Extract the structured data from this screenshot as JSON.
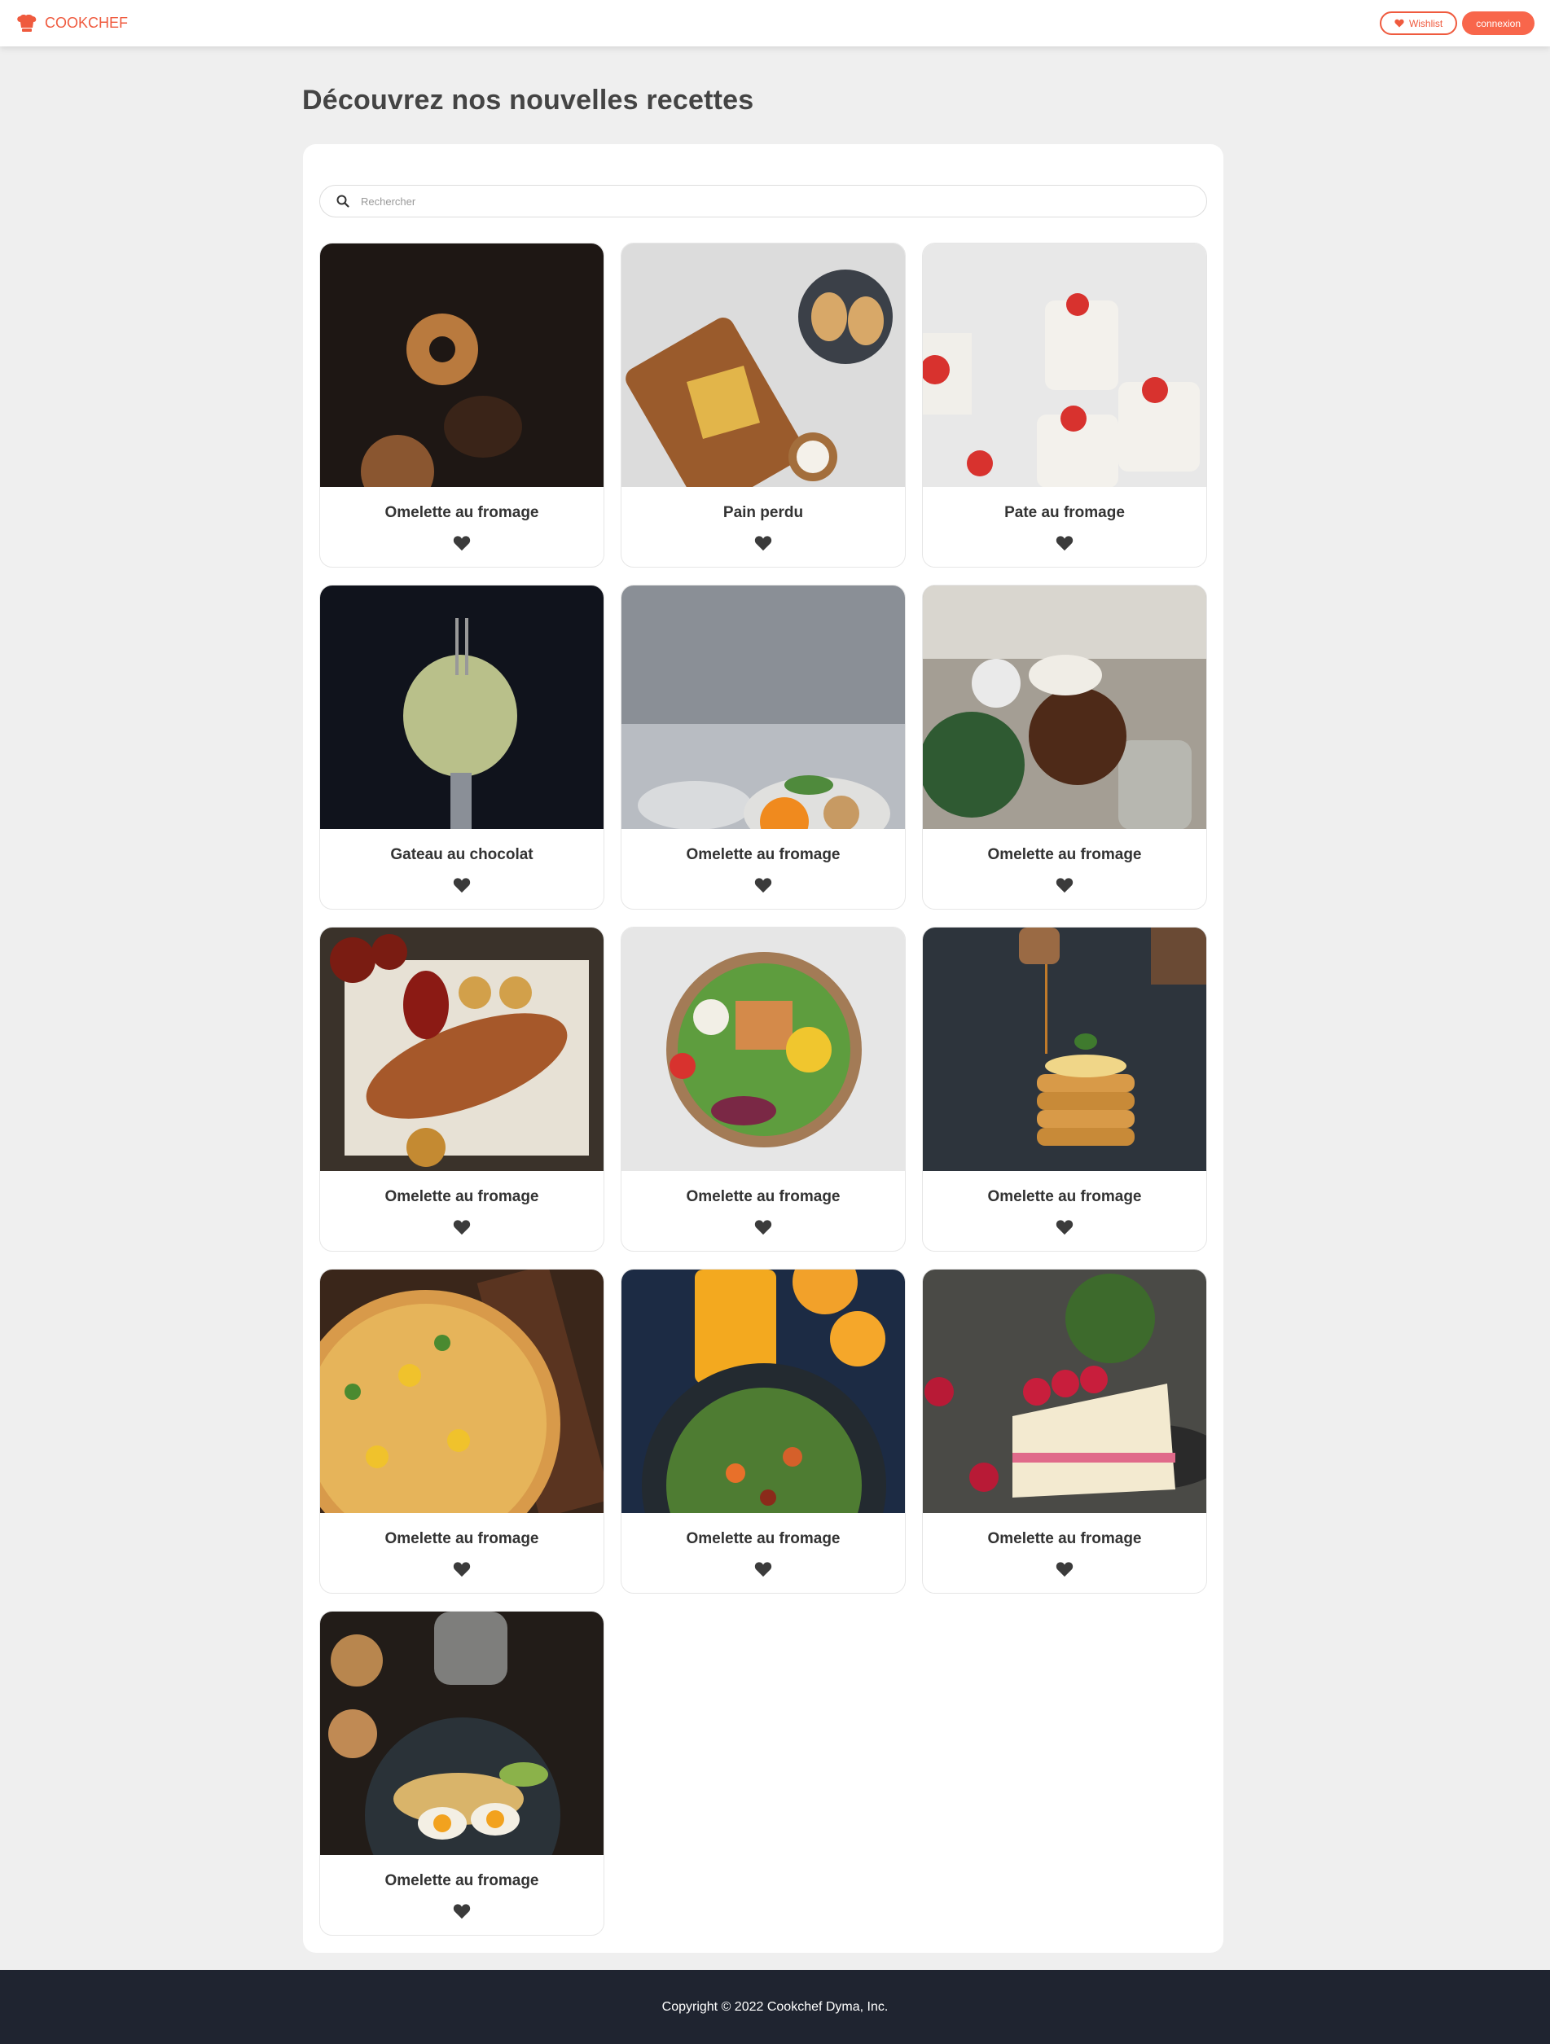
{
  "header": {
    "logo_text": "COOKCHEF",
    "wishlist_label": "Wishlist",
    "connexion_label": "connexion",
    "accent_color": "#ef5a3e"
  },
  "page_title": "Découvrez nos nouvelles recettes",
  "search": {
    "placeholder": "Rechercher",
    "value": ""
  },
  "recipes": [
    {
      "title": "Omelette au fromage",
      "photo": "dark-donuts"
    },
    {
      "title": "Pain perdu",
      "photo": "nachos-board"
    },
    {
      "title": "Pate au fromage",
      "photo": "strawberry-jars"
    },
    {
      "title": "Gateau au chocolat",
      "photo": "pasta-fork"
    },
    {
      "title": "Omelette au fromage",
      "photo": "salad-grey-bg"
    },
    {
      "title": "Omelette au fromage",
      "photo": "chocolate-sundae"
    },
    {
      "title": "Omelette au fromage",
      "photo": "grilled-skewers"
    },
    {
      "title": "Omelette au fromage",
      "photo": "salad-bowl"
    },
    {
      "title": "Omelette au fromage",
      "photo": "pancakes-syrup"
    },
    {
      "title": "Omelette au fromage",
      "photo": "pizza-board"
    },
    {
      "title": "Omelette au fromage",
      "photo": "orange-juice-salad"
    },
    {
      "title": "Omelette au fromage",
      "photo": "raspberry-cake"
    },
    {
      "title": "Omelette au fromage",
      "photo": "eggs-avocado-toast"
    }
  ],
  "footer": {
    "copyright": "Copyright © 2022 Cookchef Dyma, Inc."
  }
}
